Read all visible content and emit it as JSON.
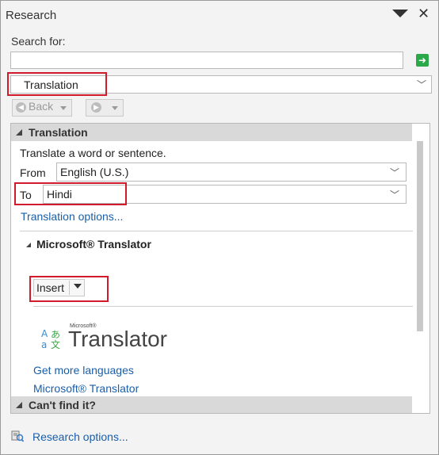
{
  "pane": {
    "title": "Research",
    "search_label": "Search for:",
    "search_value": "",
    "source_selected": "Translation"
  },
  "nav": {
    "back_label": "Back"
  },
  "translation": {
    "heading": "Translation",
    "description": "Translate a word or sentence.",
    "from_label": "From",
    "from_value": "English (U.S.)",
    "to_label": "To",
    "to_value": "Hindi",
    "options_link": "Translation options..."
  },
  "translator": {
    "heading": "Microsoft® Translator",
    "insert_label": "Insert",
    "logo_brand": "Microsoft®",
    "logo_name": "Translator",
    "more_languages": "Get more languages",
    "service_link": "Microsoft® Translator"
  },
  "cant_find": {
    "heading": "Can't find it?"
  },
  "footer": {
    "options_link": "Research options..."
  },
  "colors": {
    "highlight_box": "#d11b2c",
    "link": "#1a5ea8",
    "go_button": "#2aa84a"
  }
}
